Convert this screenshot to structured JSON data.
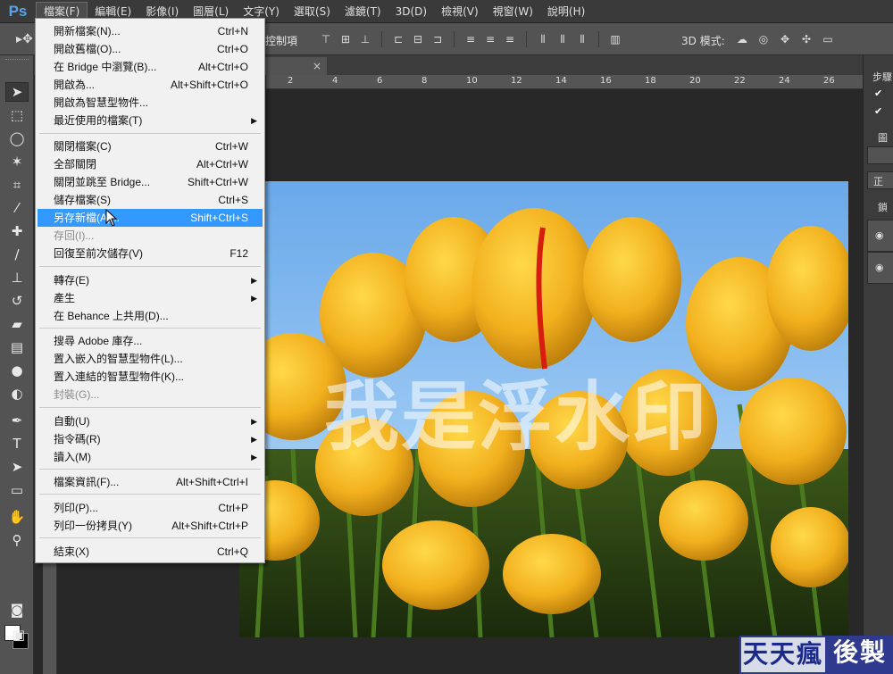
{
  "menubar": {
    "logo": "Ps",
    "items": [
      "檔案(F)",
      "編輯(E)",
      "影像(I)",
      "圖層(L)",
      "文字(Y)",
      "選取(S)",
      "濾鏡(T)",
      "3D(D)",
      "檢視(V)",
      "視窗(W)",
      "說明(H)"
    ]
  },
  "options": {
    "transform_label": "控制項",
    "mode3d_label": "3D 模式:"
  },
  "tab": {
    "close": "×"
  },
  "ruler": {
    "labels": [
      "2",
      "4",
      "6",
      "8",
      "10",
      "12",
      "14",
      "16",
      "18",
      "20",
      "22",
      "24",
      "26"
    ]
  },
  "canvas": {
    "watermark": "我是浮水印"
  },
  "file_menu": {
    "items": [
      {
        "label": "開新檔案(N)...",
        "shortcut": "Ctrl+N"
      },
      {
        "label": "開啟舊檔(O)...",
        "shortcut": "Ctrl+O"
      },
      {
        "label": "在 Bridge 中瀏覽(B)...",
        "shortcut": "Alt+Ctrl+O"
      },
      {
        "label": "開啟為...",
        "shortcut": "Alt+Shift+Ctrl+O"
      },
      {
        "label": "開啟為智慧型物件...",
        "shortcut": ""
      },
      {
        "label": "最近使用的檔案(T)",
        "shortcut": ""
      },
      {
        "label": "關閉檔案(C)",
        "shortcut": "Ctrl+W"
      },
      {
        "label": "全部關閉",
        "shortcut": "Alt+Ctrl+W"
      },
      {
        "label": "關閉並跳至 Bridge...",
        "shortcut": "Shift+Ctrl+W"
      },
      {
        "label": "儲存檔案(S)",
        "shortcut": "Ctrl+S"
      },
      {
        "label": "另存新檔(A)...",
        "shortcut": "Shift+Ctrl+S"
      },
      {
        "label": "存回(I)...",
        "shortcut": ""
      },
      {
        "label": "回復至前次儲存(V)",
        "shortcut": "F12"
      },
      {
        "label": "轉存(E)",
        "shortcut": ""
      },
      {
        "label": "產生",
        "shortcut": ""
      },
      {
        "label": "在 Behance 上共用(D)...",
        "shortcut": ""
      },
      {
        "label": "搜尋 Adobe 庫存...",
        "shortcut": ""
      },
      {
        "label": "置入嵌入的智慧型物件(L)...",
        "shortcut": ""
      },
      {
        "label": "置入連結的智慧型物件(K)...",
        "shortcut": ""
      },
      {
        "label": "封裝(G)...",
        "shortcut": ""
      },
      {
        "label": "自動(U)",
        "shortcut": ""
      },
      {
        "label": "指令碼(R)",
        "shortcut": ""
      },
      {
        "label": "讀入(M)",
        "shortcut": ""
      },
      {
        "label": "檔案資訊(F)...",
        "shortcut": "Alt+Shift+Ctrl+I"
      },
      {
        "label": "列印(P)...",
        "shortcut": "Ctrl+P"
      },
      {
        "label": "列印一份拷貝(Y)",
        "shortcut": "Alt+Shift+Ctrl+P"
      },
      {
        "label": "結束(X)",
        "shortcut": "Ctrl+Q"
      }
    ]
  },
  "right_panel": {
    "steps_label": "步驟",
    "layers_label": "圖",
    "normal_label": "正",
    "lock_label": "鎖"
  },
  "watermark_badge": {
    "left": "天天瘋",
    "right": "後製"
  },
  "colors": {
    "highlight": "#3399ff",
    "sky": "#7fb8ec",
    "tulip": "#f0b020"
  }
}
